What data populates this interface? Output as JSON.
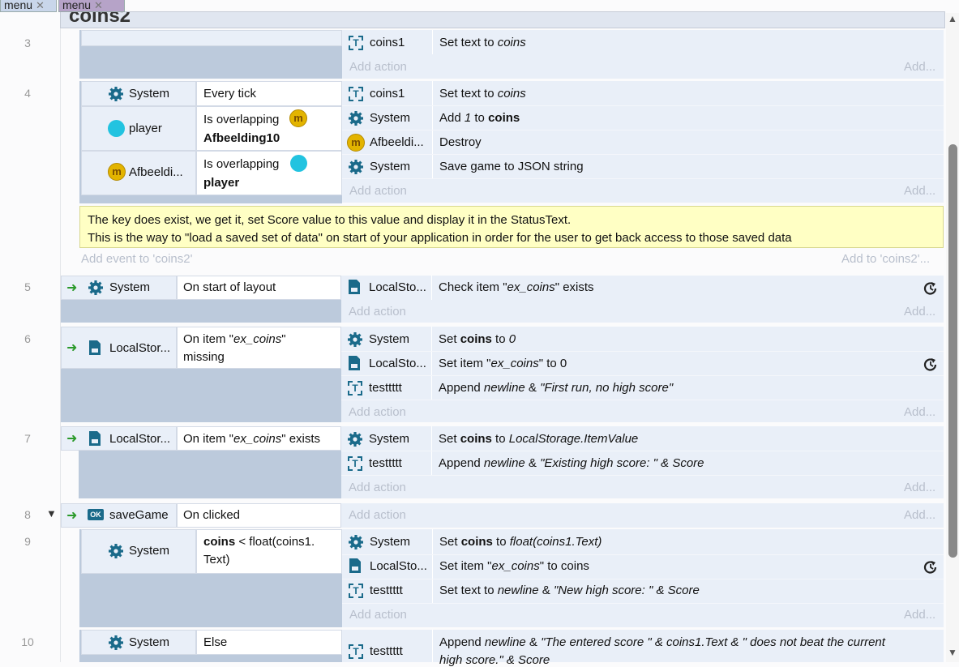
{
  "tabs": [
    {
      "label": "menu",
      "close": "✕"
    },
    {
      "label": "menu",
      "close": "✕"
    }
  ],
  "group": {
    "title": "coins2",
    "add_event": "Add event to 'coins2'",
    "add_right": "Add to 'coins2'..."
  },
  "add_action": "Add action",
  "add": "Add...",
  "comment": {
    "line1": "The key does exist, we get it, set Score value to this value and display it in the StatusText.",
    "line2": "This is the way to \"load a saved set of data\" on start of your application in order for the user to get back access to those saved data"
  },
  "events": {
    "e3": {
      "num": "3",
      "a1_obj": "coins1",
      "a1_text": "Set text to ",
      "a1_it": "coins"
    },
    "e4": {
      "num": "4",
      "c1_obj": "System",
      "c1_text": "Every tick",
      "c2_obj": "player",
      "c2_text": "Is overlapping",
      "c2_target": "Afbeelding10",
      "c3_obj": "Afbeeldi...",
      "c3_text": "Is overlapping",
      "c3_target": "player",
      "a1_obj": "coins1",
      "a1_text": "Set text to ",
      "a1_it": "coins",
      "a2_obj": "System",
      "a2_pre": "Add ",
      "a2_it": "1",
      "a2_mid": " to ",
      "a2_b": "coins",
      "a3_obj": "Afbeeldi...",
      "a3_text": "Destroy",
      "a4_obj": "System",
      "a4_text": "Save game to JSON string"
    },
    "e5": {
      "num": "5",
      "c_obj": "System",
      "c_text": "On start of layout",
      "a1_obj": "LocalSto...",
      "a1_pre": "Check item \"",
      "a1_it": "ex_coins",
      "a1_post": "\" exists"
    },
    "e6": {
      "num": "6",
      "c_obj": "LocalStor...",
      "c_pre": "On item \"",
      "c_it": "ex_coins",
      "c_post": "\"",
      "c_line2": "missing",
      "a1_obj": "System",
      "a1_pre": "Set ",
      "a1_b": "coins",
      "a1_mid": " to ",
      "a1_it": "0",
      "a2_obj": "LocalSto...",
      "a2_pre": "Set item \"",
      "a2_it": "ex_coins",
      "a2_post": "\" to 0",
      "a3_obj": "testtttt",
      "a3_pre": "Append ",
      "a3_it": "newline",
      "a3_mid": " & ",
      "a3_it2": "\"First run, no high score\""
    },
    "e7": {
      "num": "7",
      "c_obj": "LocalStor...",
      "c_pre": "On item \"",
      "c_it": "ex_coins",
      "c_post": "\" exists",
      "a1_obj": "System",
      "a1_pre": "Set ",
      "a1_b": "coins",
      "a1_mid": " to ",
      "a1_it": "LocalStorage.ItemValue",
      "a2_obj": "testtttt",
      "a2_pre": "Append ",
      "a2_it": "newline",
      "a2_mid": " & ",
      "a2_it2": "\"Existing high score: \" & Score"
    },
    "e8": {
      "num": "8",
      "toggle": "▼",
      "c_obj": "saveGame",
      "c_icon": "OK",
      "c_text": "On clicked"
    },
    "e9": {
      "num": "9",
      "c_obj": "System",
      "c_b": "coins",
      "c_text": " < float(coins1.",
      "c_line2": "Text)",
      "a1_obj": "System",
      "a1_pre": "Set ",
      "a1_b": "coins",
      "a1_mid": " to ",
      "a1_it": "float(coins1.Text)",
      "a2_obj": "LocalSto...",
      "a2_pre": "Set item \"",
      "a2_it": "ex_coins",
      "a2_post": "\" to coins",
      "a3_obj": "testtttt",
      "a3_pre": "Set text to ",
      "a3_it": "newline",
      "a3_mid": " & ",
      "a3_it2": "\"New high score: \" & Score"
    },
    "e10": {
      "num": "10",
      "c_obj": "System",
      "c_text": "Else",
      "a1_obj": "testtttt",
      "a1_pre": "Append ",
      "a1_it": "newline",
      "a1_mid": " & ",
      "a1_it2": "\"The entered score \" & coins1.Text & \" does not beat the current",
      "a1_line2": "high score.\" & Score"
    }
  },
  "icons": {
    "text_object": "T",
    "coin_glyph": "m"
  },
  "scroll": {
    "up": "▲",
    "down": "▼"
  }
}
